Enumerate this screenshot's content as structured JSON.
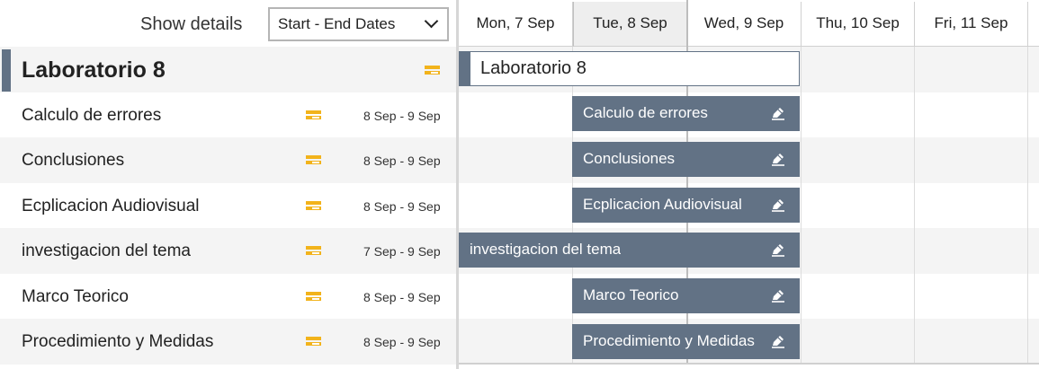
{
  "toolbar": {
    "show_details_label": "Show details",
    "view_select_value": "Start - End Dates"
  },
  "days": [
    "Mon, 7 Sep",
    "Tue, 8 Sep",
    "Wed, 9 Sep",
    "Thu, 10 Sep",
    "Fri, 11 Sep"
  ],
  "today_day": "Tue, 8 Sep",
  "group": {
    "title": "Laboratorio 8"
  },
  "tasks": [
    {
      "name": "Calculo de errores",
      "dates": "8 Sep - 9 Sep",
      "bar_label": "Calculo de errores"
    },
    {
      "name": "Conclusiones",
      "dates": "8 Sep - 9 Sep",
      "bar_label": "Conclusiones"
    },
    {
      "name": "Ecplicacion Audiovisual",
      "dates": "8 Sep - 9 Sep",
      "bar_label": "Ecplicacion Audiovisual"
    },
    {
      "name": "investigacion del tema",
      "dates": "7 Sep - 9 Sep",
      "bar_label": "investigacion del tema"
    },
    {
      "name": "Marco Teorico",
      "dates": "8 Sep - 9 Sep",
      "bar_label": "Marco Teorico"
    },
    {
      "name": "Procedimiento y Medidas",
      "dates": "8 Sep - 9 Sep",
      "bar_label": "Procedimiento y Medidas"
    }
  ],
  "colors": {
    "bar": "#627285",
    "task_icon": "#f2b31b",
    "alt_row": "#f4f4f4"
  },
  "icons": {
    "dropdown": "chevron-down-icon",
    "task_details": "task-details-icon",
    "edit": "pencil-icon"
  }
}
